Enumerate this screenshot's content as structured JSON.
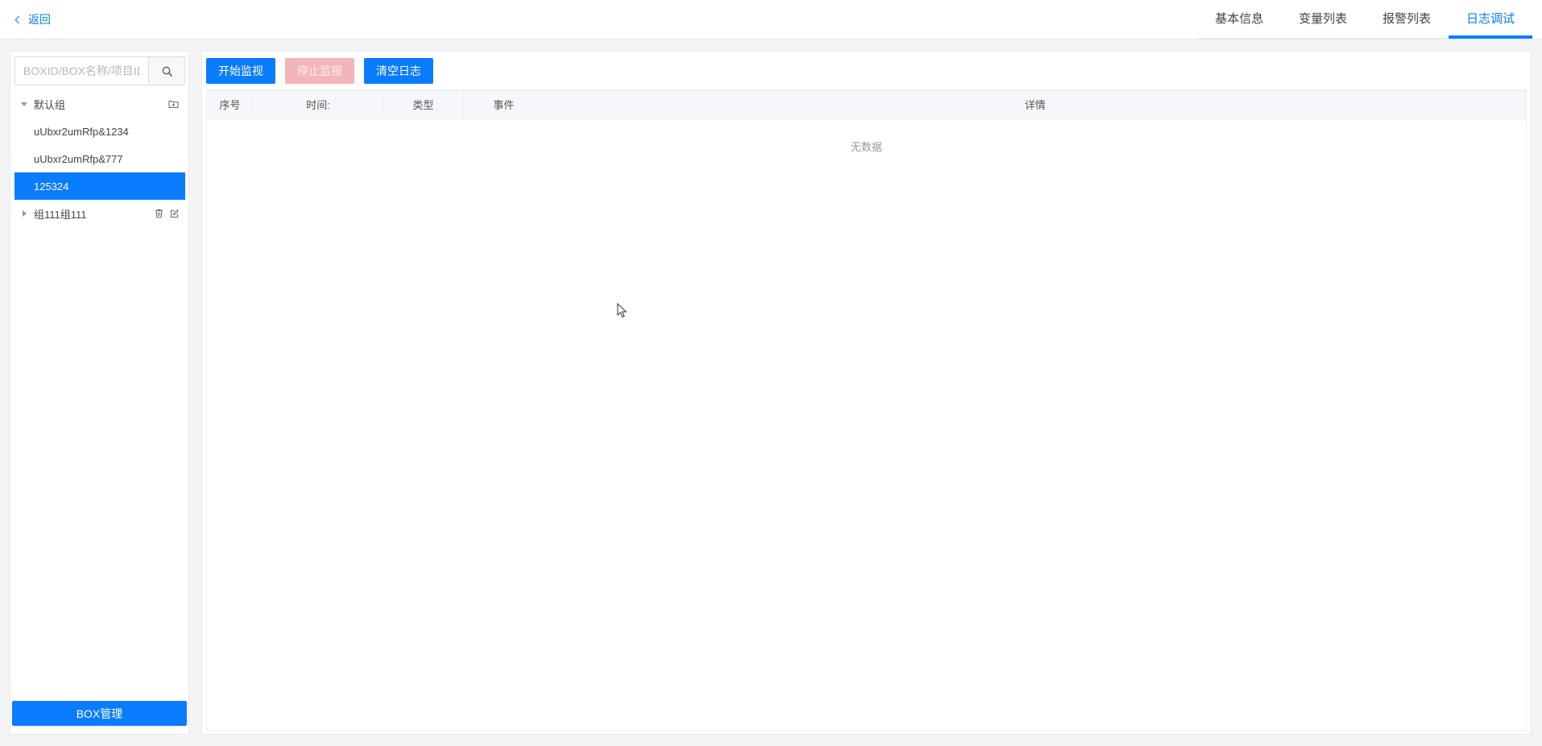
{
  "header": {
    "back_label": "返回",
    "tabs": [
      {
        "label": "基本信息",
        "active": false
      },
      {
        "label": "变量列表",
        "active": false
      },
      {
        "label": "报警列表",
        "active": false
      },
      {
        "label": "日志调试",
        "active": true
      }
    ]
  },
  "sidebar": {
    "search": {
      "placeholder": "BOXID/BOX名称/项目ID",
      "value": ""
    },
    "groups": [
      {
        "label": "默认组",
        "expanded": true,
        "items": [
          {
            "label": "uUbxr2umRfp&1234",
            "selected": false
          },
          {
            "label": "uUbxr2umRfp&777",
            "selected": false
          },
          {
            "label": "125324",
            "selected": true
          }
        ]
      },
      {
        "label": "组111组111",
        "expanded": false,
        "items": []
      }
    ],
    "box_mgmt_label": "BOX管理"
  },
  "main": {
    "toolbar": {
      "start_label": "开始监视",
      "stop_label": "停止监视",
      "clear_label": "清空日志"
    },
    "table": {
      "columns": [
        "序号",
        "时间:",
        "类型",
        "事件",
        "详情"
      ],
      "rows": [],
      "empty_text": "无数据"
    }
  },
  "colors": {
    "accent": "#0a7cff",
    "disabled_button": "#f4b5b9",
    "selected_row_bg": "#0a7cff"
  }
}
